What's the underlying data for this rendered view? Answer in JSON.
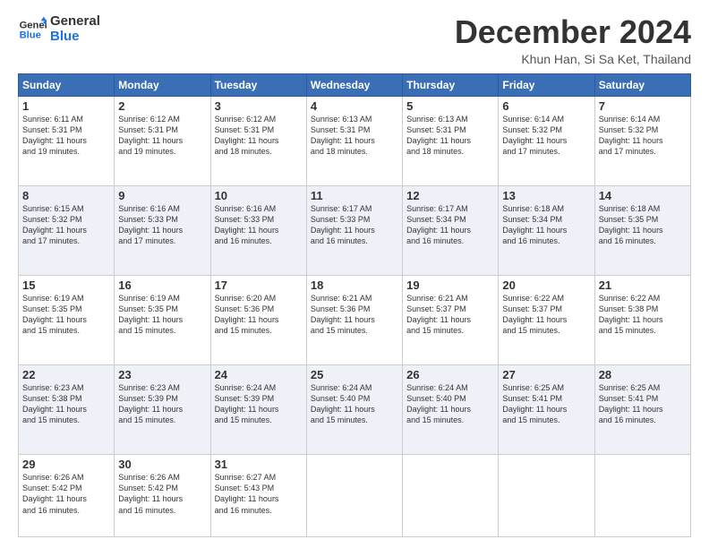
{
  "logo": {
    "line1": "General",
    "line2": "Blue"
  },
  "title": "December 2024",
  "location": "Khun Han, Si Sa Ket, Thailand",
  "days_header": [
    "Sunday",
    "Monday",
    "Tuesday",
    "Wednesday",
    "Thursday",
    "Friday",
    "Saturday"
  ],
  "weeks": [
    [
      {
        "day": "1",
        "sunrise": "6:11 AM",
        "sunset": "5:31 PM",
        "daylight": "11 hours and 19 minutes."
      },
      {
        "day": "2",
        "sunrise": "6:12 AM",
        "sunset": "5:31 PM",
        "daylight": "11 hours and 19 minutes."
      },
      {
        "day": "3",
        "sunrise": "6:12 AM",
        "sunset": "5:31 PM",
        "daylight": "11 hours and 18 minutes."
      },
      {
        "day": "4",
        "sunrise": "6:13 AM",
        "sunset": "5:31 PM",
        "daylight": "11 hours and 18 minutes."
      },
      {
        "day": "5",
        "sunrise": "6:13 AM",
        "sunset": "5:31 PM",
        "daylight": "11 hours and 18 minutes."
      },
      {
        "day": "6",
        "sunrise": "6:14 AM",
        "sunset": "5:32 PM",
        "daylight": "11 hours and 17 minutes."
      },
      {
        "day": "7",
        "sunrise": "6:14 AM",
        "sunset": "5:32 PM",
        "daylight": "11 hours and 17 minutes."
      }
    ],
    [
      {
        "day": "8",
        "sunrise": "6:15 AM",
        "sunset": "5:32 PM",
        "daylight": "11 hours and 17 minutes."
      },
      {
        "day": "9",
        "sunrise": "6:16 AM",
        "sunset": "5:33 PM",
        "daylight": "11 hours and 17 minutes."
      },
      {
        "day": "10",
        "sunrise": "6:16 AM",
        "sunset": "5:33 PM",
        "daylight": "11 hours and 16 minutes."
      },
      {
        "day": "11",
        "sunrise": "6:17 AM",
        "sunset": "5:33 PM",
        "daylight": "11 hours and 16 minutes."
      },
      {
        "day": "12",
        "sunrise": "6:17 AM",
        "sunset": "5:34 PM",
        "daylight": "11 hours and 16 minutes."
      },
      {
        "day": "13",
        "sunrise": "6:18 AM",
        "sunset": "5:34 PM",
        "daylight": "11 hours and 16 minutes."
      },
      {
        "day": "14",
        "sunrise": "6:18 AM",
        "sunset": "5:35 PM",
        "daylight": "11 hours and 16 minutes."
      }
    ],
    [
      {
        "day": "15",
        "sunrise": "6:19 AM",
        "sunset": "5:35 PM",
        "daylight": "11 hours and 15 minutes."
      },
      {
        "day": "16",
        "sunrise": "6:19 AM",
        "sunset": "5:35 PM",
        "daylight": "11 hours and 15 minutes."
      },
      {
        "day": "17",
        "sunrise": "6:20 AM",
        "sunset": "5:36 PM",
        "daylight": "11 hours and 15 minutes."
      },
      {
        "day": "18",
        "sunrise": "6:21 AM",
        "sunset": "5:36 PM",
        "daylight": "11 hours and 15 minutes."
      },
      {
        "day": "19",
        "sunrise": "6:21 AM",
        "sunset": "5:37 PM",
        "daylight": "11 hours and 15 minutes."
      },
      {
        "day": "20",
        "sunrise": "6:22 AM",
        "sunset": "5:37 PM",
        "daylight": "11 hours and 15 minutes."
      },
      {
        "day": "21",
        "sunrise": "6:22 AM",
        "sunset": "5:38 PM",
        "daylight": "11 hours and 15 minutes."
      }
    ],
    [
      {
        "day": "22",
        "sunrise": "6:23 AM",
        "sunset": "5:38 PM",
        "daylight": "11 hours and 15 minutes."
      },
      {
        "day": "23",
        "sunrise": "6:23 AM",
        "sunset": "5:39 PM",
        "daylight": "11 hours and 15 minutes."
      },
      {
        "day": "24",
        "sunrise": "6:24 AM",
        "sunset": "5:39 PM",
        "daylight": "11 hours and 15 minutes."
      },
      {
        "day": "25",
        "sunrise": "6:24 AM",
        "sunset": "5:40 PM",
        "daylight": "11 hours and 15 minutes."
      },
      {
        "day": "26",
        "sunrise": "6:24 AM",
        "sunset": "5:40 PM",
        "daylight": "11 hours and 15 minutes."
      },
      {
        "day": "27",
        "sunrise": "6:25 AM",
        "sunset": "5:41 PM",
        "daylight": "11 hours and 15 minutes."
      },
      {
        "day": "28",
        "sunrise": "6:25 AM",
        "sunset": "5:41 PM",
        "daylight": "11 hours and 16 minutes."
      }
    ],
    [
      {
        "day": "29",
        "sunrise": "6:26 AM",
        "sunset": "5:42 PM",
        "daylight": "11 hours and 16 minutes."
      },
      {
        "day": "30",
        "sunrise": "6:26 AM",
        "sunset": "5:42 PM",
        "daylight": "11 hours and 16 minutes."
      },
      {
        "day": "31",
        "sunrise": "6:27 AM",
        "sunset": "5:43 PM",
        "daylight": "11 hours and 16 minutes."
      },
      null,
      null,
      null,
      null
    ]
  ],
  "labels": {
    "sunrise": "Sunrise:",
    "sunset": "Sunset:",
    "daylight": "Daylight:"
  }
}
